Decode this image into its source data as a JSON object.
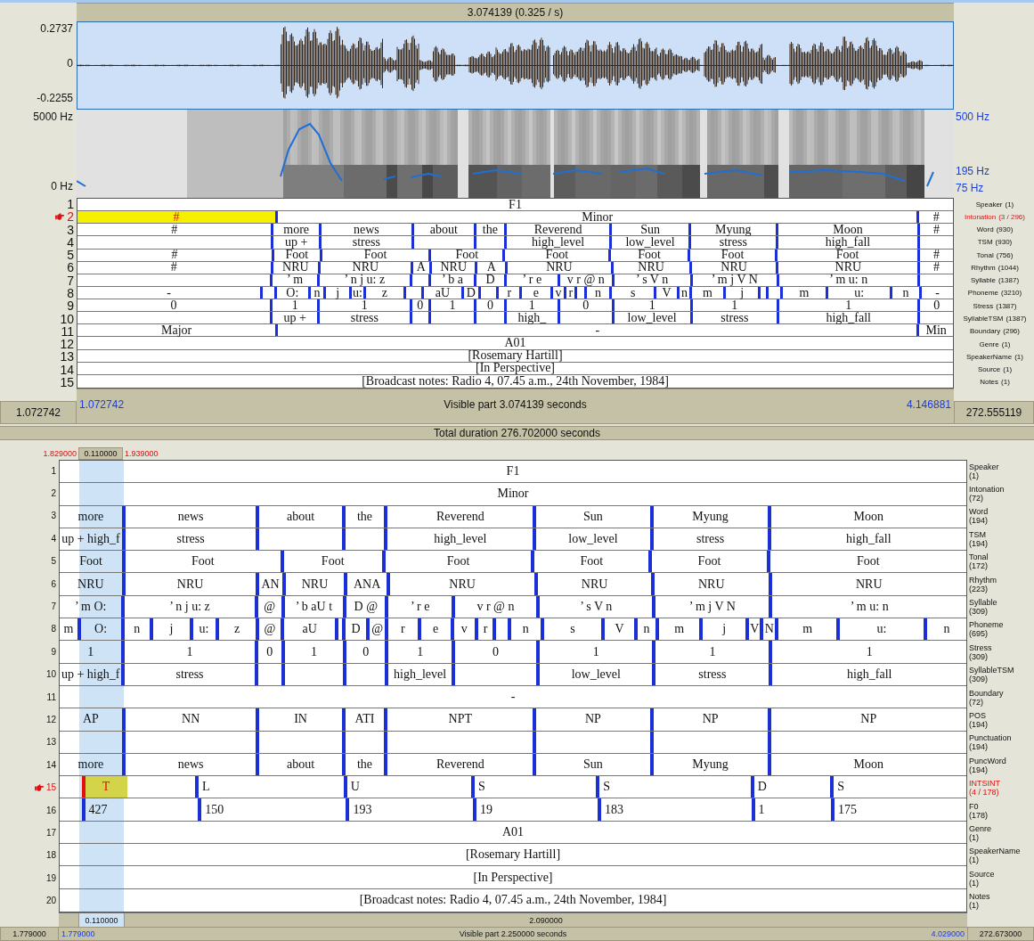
{
  "top_panel": {
    "title": "3.074139 (0.325 / s)",
    "waveform": {
      "y_max": "0.2737",
      "y_zero": "0",
      "y_min": "-0.2255"
    },
    "spectrogram": {
      "freq_max": "5000 Hz",
      "freq_min": "0 Hz",
      "pitch_max": "500 Hz",
      "pitch_mid": "195 Hz",
      "pitch_min": "75 Hz"
    },
    "tiers": [
      {
        "number": "1",
        "selected": false,
        "name": "Speaker",
        "count": "(1)",
        "intervals": [
          {
            "text": "F1",
            "selected": false
          }
        ]
      },
      {
        "number": "2",
        "selected": true,
        "name": "Intonation",
        "count": "(3 / 296)",
        "intervals": [
          {
            "text": "#",
            "selected": true
          },
          {
            "text": "Minor",
            "selected": false
          },
          {
            "text": "#",
            "selected": false
          }
        ]
      },
      {
        "number": "3",
        "selected": false,
        "name": "Word",
        "count": "(930)",
        "intervals": [
          {
            "text": "#",
            "selected": false
          },
          {
            "text": "more",
            "selected": false
          },
          {
            "text": "news",
            "selected": false
          },
          {
            "text": "about",
            "selected": false
          },
          {
            "text": "the",
            "selected": false
          },
          {
            "text": "Reverend",
            "selected": false
          },
          {
            "text": "Sun",
            "selected": false
          },
          {
            "text": "Myung",
            "selected": false
          },
          {
            "text": "Moon",
            "selected": false
          },
          {
            "text": "#",
            "selected": false
          }
        ]
      },
      {
        "number": "4",
        "selected": false,
        "name": "TSM",
        "count": "(930)",
        "intervals": [
          {
            "selected": false
          },
          {
            "text": "up +",
            "selected": false
          },
          {
            "text": "stress",
            "selected": false
          },
          {
            "selected": false
          },
          {
            "selected": false
          },
          {
            "text": "high_level",
            "selected": false
          },
          {
            "text": "low_level",
            "selected": false
          },
          {
            "text": "stress",
            "selected": false
          },
          {
            "text": "high_fall",
            "selected": false
          },
          {
            "selected": false
          }
        ]
      },
      {
        "number": "5",
        "selected": false,
        "name": "Tonal",
        "count": "(756)",
        "intervals": [
          {
            "text": "#",
            "selected": false
          },
          {
            "text": "Foot",
            "selected": false
          },
          {
            "text": "Foot",
            "selected": false
          },
          {
            "text": "Foot",
            "selected": false
          },
          {
            "text": "Foot",
            "selected": false
          },
          {
            "text": "Foot",
            "selected": false
          },
          {
            "text": "Foot",
            "selected": false
          },
          {
            "text": "Foot",
            "selected": false
          },
          {
            "text": "#",
            "selected": false
          }
        ]
      },
      {
        "number": "6",
        "selected": false,
        "name": "Rhythm",
        "count": "(1044)",
        "intervals": [
          {
            "text": "#",
            "selected": false
          },
          {
            "text": "NRU",
            "selected": false
          },
          {
            "text": "NRU",
            "selected": false
          },
          {
            "text": "A",
            "selected": false
          },
          {
            "text": "NRU",
            "selected": false
          },
          {
            "text": "A",
            "selected": false
          },
          {
            "text": "NRU",
            "selected": false
          },
          {
            "text": "NRU",
            "selected": false
          },
          {
            "text": "NRU",
            "selected": false
          },
          {
            "text": "NRU",
            "selected": false
          },
          {
            "text": "#",
            "selected": false
          }
        ]
      },
      {
        "number": "7",
        "selected": false,
        "name": "Syllable",
        "count": "(1387)",
        "intervals": [
          {
            "selected": false
          },
          {
            "text": "’ m",
            "selected": false
          },
          {
            "text": "’ n j u: z",
            "selected": false
          },
          {
            "selected": false
          },
          {
            "text": "’ b a",
            "selected": false
          },
          {
            "text": "D",
            "selected": false
          },
          {
            "text": "’ r e",
            "selected": false
          },
          {
            "text": "v r @ n",
            "selected": false
          },
          {
            "text": "’ s V n",
            "selected": false
          },
          {
            "text": "’ m j V N",
            "selected": false
          },
          {
            "text": "’ m u: n",
            "selected": false
          },
          {
            "selected": false
          }
        ]
      },
      {
        "number": "8",
        "selected": false,
        "name": "Phoneme",
        "count": "(3210)",
        "intervals": [
          {
            "text": "-",
            "selected": false
          },
          {
            "selected": false
          },
          {
            "text": "O:",
            "selected": false
          },
          {
            "text": "n",
            "selected": false
          },
          {
            "text": "j",
            "selected": false
          },
          {
            "text": "u:",
            "selected": false
          },
          {
            "text": "z",
            "selected": false
          },
          {
            "selected": false
          },
          {
            "text": "aU",
            "selected": false
          },
          {
            "text": "D",
            "selected": false
          },
          {
            "selected": false
          },
          {
            "text": "r",
            "selected": false
          },
          {
            "text": "e",
            "selected": false
          },
          {
            "text": "v",
            "selected": false
          },
          {
            "text": "r",
            "selected": false
          },
          {
            "selected": false
          },
          {
            "text": "n",
            "selected": false
          },
          {
            "text": "s",
            "selected": false
          },
          {
            "text": "V",
            "selected": false
          },
          {
            "text": "n",
            "selected": false
          },
          {
            "text": "m",
            "selected": false
          },
          {
            "text": "j",
            "selected": false
          },
          {
            "selected": false
          },
          {
            "selected": false
          },
          {
            "text": "m",
            "selected": false
          },
          {
            "text": "u:",
            "selected": false
          },
          {
            "text": "n",
            "selected": false
          },
          {
            "text": "-",
            "selected": false
          }
        ]
      },
      {
        "number": "9",
        "selected": false,
        "name": "Stress",
        "count": "(1387)",
        "intervals": [
          {
            "text": "0",
            "selected": false
          },
          {
            "text": "1",
            "selected": false
          },
          {
            "text": "1",
            "selected": false
          },
          {
            "text": "0",
            "selected": false
          },
          {
            "text": "1",
            "selected": false
          },
          {
            "text": "0",
            "selected": false
          },
          {
            "text": "1",
            "selected": false
          },
          {
            "text": "0",
            "selected": false
          },
          {
            "text": "1",
            "selected": false
          },
          {
            "text": "1",
            "selected": false
          },
          {
            "text": "1",
            "selected": false
          },
          {
            "text": "0",
            "selected": false
          }
        ]
      },
      {
        "number": "10",
        "selected": false,
        "name": "SyllableTSM",
        "count": "(1387)",
        "intervals": [
          {
            "selected": false
          },
          {
            "text": "up +",
            "selected": false
          },
          {
            "text": "stress",
            "selected": false
          },
          {
            "selected": false
          },
          {
            "selected": false
          },
          {
            "selected": false
          },
          {
            "text": "high_",
            "selected": false
          },
          {
            "selected": false
          },
          {
            "text": "low_level",
            "selected": false
          },
          {
            "text": "stress",
            "selected": false
          },
          {
            "text": "high_fall",
            "selected": false
          },
          {
            "selected": false
          }
        ]
      },
      {
        "number": "11",
        "selected": false,
        "name": "Boundary",
        "count": "(296)",
        "intervals": [
          {
            "text": "Major",
            "selected": false
          },
          {
            "text": "-",
            "selected": false
          },
          {
            "text": "Min",
            "selected": false
          }
        ]
      },
      {
        "number": "12",
        "selected": false,
        "name": "Genre",
        "count": "(1)",
        "intervals": [
          {
            "text": "A01",
            "selected": false
          }
        ]
      },
      {
        "number": "13",
        "selected": false,
        "name": "SpeakerName",
        "count": "(1)",
        "intervals": [
          {
            "text": "[Rosemary Hartill]",
            "selected": false
          }
        ]
      },
      {
        "number": "14",
        "selected": false,
        "name": "Source",
        "count": "(1)",
        "intervals": [
          {
            "text": "[In Perspective]",
            "selected": false
          }
        ]
      },
      {
        "number": "15",
        "selected": false,
        "name": "Notes",
        "count": "(1)",
        "intervals": [
          {
            "text": "[Broadcast notes: Radio 4, 07.45 a.m., 24th November, 1984]",
            "selected": false
          }
        ]
      }
    ],
    "footer": {
      "left_box": "1.072742",
      "window_start": "1.072742",
      "visible": "Visible part 3.074139 seconds",
      "window_end": "4.146881",
      "right_box": "272.555119"
    }
  },
  "total_duration": "Total duration 276.702000 seconds",
  "bottom_panel": {
    "selection": {
      "start": "1.829000",
      "duration": "0.110000",
      "end": "1.939000"
    },
    "tiers": [
      {
        "number": "1",
        "selected": false,
        "kind": "interval",
        "name": "Speaker",
        "count": "(1)",
        "intervals": [
          {
            "text": "F1",
            "selected": false
          }
        ]
      },
      {
        "number": "2",
        "selected": false,
        "kind": "interval",
        "name": "Intonation",
        "count": "(72)",
        "intervals": [
          {
            "text": "Minor",
            "selected": false
          }
        ]
      },
      {
        "number": "3",
        "selected": false,
        "kind": "interval",
        "name": "Word",
        "count": "(194)",
        "intervals": [
          {
            "text": "more",
            "selected": false
          },
          {
            "text": "news",
            "selected": false
          },
          {
            "text": "about",
            "selected": false
          },
          {
            "text": "the",
            "selected": false
          },
          {
            "text": "Reverend",
            "selected": false
          },
          {
            "text": "Sun",
            "selected": false
          },
          {
            "text": "Myung",
            "selected": false
          },
          {
            "text": "Moon",
            "selected": false
          }
        ]
      },
      {
        "number": "4",
        "selected": false,
        "kind": "interval",
        "name": "TSM",
        "count": "(194)",
        "intervals": [
          {
            "text": "up + high_f",
            "selected": false
          },
          {
            "text": "stress",
            "selected": false
          },
          {
            "selected": false
          },
          {
            "selected": false
          },
          {
            "text": "high_level",
            "selected": false
          },
          {
            "text": "low_level",
            "selected": false
          },
          {
            "text": "stress",
            "selected": false
          },
          {
            "text": "high_fall",
            "selected": false
          }
        ]
      },
      {
        "number": "5",
        "selected": false,
        "kind": "interval",
        "name": "Tonal",
        "count": "(172)",
        "intervals": [
          {
            "text": "Foot",
            "selected": false
          },
          {
            "text": "Foot",
            "selected": false
          },
          {
            "text": "Foot",
            "selected": false
          },
          {
            "text": "Foot",
            "selected": false
          },
          {
            "text": "Foot",
            "selected": false
          },
          {
            "text": "Foot",
            "selected": false
          },
          {
            "text": "Foot",
            "selected": false
          }
        ]
      },
      {
        "number": "6",
        "selected": false,
        "kind": "interval",
        "name": "Rhythm",
        "count": "(223)",
        "intervals": [
          {
            "text": "NRU",
            "selected": false
          },
          {
            "text": "NRU",
            "selected": false
          },
          {
            "text": "AN",
            "selected": false
          },
          {
            "text": "NRU",
            "selected": false
          },
          {
            "text": "ANA",
            "selected": false
          },
          {
            "text": "NRU",
            "selected": false
          },
          {
            "text": "NRU",
            "selected": false
          },
          {
            "text": "NRU",
            "selected": false
          },
          {
            "text": "NRU",
            "selected": false
          }
        ]
      },
      {
        "number": "7",
        "selected": false,
        "kind": "interval",
        "name": "Syllable",
        "count": "(309)",
        "intervals": [
          {
            "text": "’ m O:",
            "selected": false
          },
          {
            "text": "’ n j u: z",
            "selected": false
          },
          {
            "text": "@",
            "selected": false
          },
          {
            "text": "’ b aU t",
            "selected": false
          },
          {
            "text": "D @",
            "selected": false
          },
          {
            "text": "’ r e",
            "selected": false
          },
          {
            "text": "v r @ n",
            "selected": false
          },
          {
            "text": "’ s V n",
            "selected": false
          },
          {
            "text": "’ m j V N",
            "selected": false
          },
          {
            "text": "’ m u: n",
            "selected": false
          }
        ]
      },
      {
        "number": "8",
        "selected": false,
        "kind": "interval",
        "name": "Phoneme",
        "count": "(695)",
        "intervals": [
          {
            "text": "m",
            "selected": false
          },
          {
            "text": "O:",
            "selected": false
          },
          {
            "text": "n",
            "selected": false
          },
          {
            "text": "j",
            "selected": false
          },
          {
            "text": "u:",
            "selected": false
          },
          {
            "text": "z",
            "selected": false
          },
          {
            "text": "@",
            "selected": false
          },
          {
            "text": "aU",
            "selected": false
          },
          {
            "selected": false
          },
          {
            "text": "D",
            "selected": false
          },
          {
            "text": "@",
            "selected": false
          },
          {
            "text": "r",
            "selected": false
          },
          {
            "text": "e",
            "selected": false
          },
          {
            "text": "v",
            "selected": false
          },
          {
            "text": "r",
            "selected": false
          },
          {
            "selected": false
          },
          {
            "text": "n",
            "selected": false
          },
          {
            "text": "s",
            "selected": false
          },
          {
            "text": "V",
            "selected": false
          },
          {
            "text": "n",
            "selected": false
          },
          {
            "text": "m",
            "selected": false
          },
          {
            "text": "j",
            "selected": false
          },
          {
            "text": "V",
            "selected": false
          },
          {
            "text": "N",
            "selected": false
          },
          {
            "text": "m",
            "selected": false
          },
          {
            "text": "u:",
            "selected": false
          },
          {
            "text": "n",
            "selected": false
          }
        ]
      },
      {
        "number": "9",
        "selected": false,
        "kind": "interval",
        "name": "Stress",
        "count": "(309)",
        "intervals": [
          {
            "text": "1",
            "selected": false
          },
          {
            "text": "1",
            "selected": false
          },
          {
            "text": "0",
            "selected": false
          },
          {
            "text": "1",
            "selected": false
          },
          {
            "text": "0",
            "selected": false
          },
          {
            "text": "1",
            "selected": false
          },
          {
            "text": "0",
            "selected": false
          },
          {
            "text": "1",
            "selected": false
          },
          {
            "text": "1",
            "selected": false
          },
          {
            "text": "1",
            "selected": false
          }
        ]
      },
      {
        "number": "10",
        "selected": false,
        "kind": "interval",
        "name": "SyllableTSM",
        "count": "(309)",
        "intervals": [
          {
            "text": "up + high_f",
            "selected": false
          },
          {
            "text": "stress",
            "selected": false
          },
          {
            "selected": false
          },
          {
            "selected": false
          },
          {
            "selected": false
          },
          {
            "text": "high_level",
            "selected": false
          },
          {
            "selected": false
          },
          {
            "text": "low_level",
            "selected": false
          },
          {
            "text": "stress",
            "selected": false
          },
          {
            "text": "high_fall",
            "selected": false
          }
        ]
      },
      {
        "number": "11",
        "selected": false,
        "kind": "interval",
        "name": "Boundary",
        "count": "(72)",
        "intervals": [
          {
            "text": "-",
            "selected": false
          }
        ]
      },
      {
        "number": "12",
        "selected": false,
        "kind": "interval",
        "name": "POS",
        "count": "(194)",
        "intervals": [
          {
            "text": "AP",
            "selected": false
          },
          {
            "text": "NN",
            "selected": false
          },
          {
            "text": "IN",
            "selected": false
          },
          {
            "text": "ATI",
            "selected": false
          },
          {
            "text": "NPT",
            "selected": false
          },
          {
            "text": "NP",
            "selected": false
          },
          {
            "text": "NP",
            "selected": false
          },
          {
            "text": "NP",
            "selected": false
          }
        ]
      },
      {
        "number": "13",
        "selected": false,
        "kind": "interval",
        "name": "Punctuation",
        "count": "(194)",
        "intervals": [
          {
            "selected": false
          },
          {
            "selected": false
          },
          {
            "selected": false
          },
          {
            "selected": false
          },
          {
            "selected": false
          },
          {
            "selected": false
          },
          {
            "selected": false
          },
          {
            "selected": false
          }
        ]
      },
      {
        "number": "14",
        "selected": false,
        "kind": "interval",
        "name": "PuncWord",
        "count": "(194)",
        "intervals": [
          {
            "text": "more",
            "selected": false
          },
          {
            "text": "news",
            "selected": false
          },
          {
            "text": "about",
            "selected": false
          },
          {
            "text": "the",
            "selected": false
          },
          {
            "text": "Reverend",
            "selected": false
          },
          {
            "text": "Sun",
            "selected": false
          },
          {
            "text": "Myung",
            "selected": false
          },
          {
            "text": "Moon",
            "selected": false
          }
        ]
      },
      {
        "number": "15",
        "selected": true,
        "kind": "point",
        "name": "INTSINT",
        "count": "(4 / 178)",
        "intervals": [
          {
            "selected": false
          },
          {
            "text": "T",
            "selected": true
          },
          {
            "selected": false
          },
          {
            "text": "L",
            "selected": false
          },
          {
            "text": "U",
            "selected": false
          },
          {
            "text": "S",
            "selected": false
          },
          {
            "text": "S",
            "selected": false
          },
          {
            "text": "D",
            "selected": false
          },
          {
            "text": "S",
            "selected": false
          }
        ]
      },
      {
        "number": "16",
        "selected": false,
        "kind": "point",
        "name": "F0",
        "count": "(178)",
        "intervals": [
          {
            "selected": false
          },
          {
            "text": "427",
            "selected": false
          },
          {
            "selected": false
          },
          {
            "text": "150",
            "selected": false
          },
          {
            "text": "193",
            "selected": false
          },
          {
            "text": "19",
            "selected": false
          },
          {
            "text": "183",
            "selected": false
          },
          {
            "text": "1",
            "selected": false
          },
          {
            "text": "175",
            "selected": false
          }
        ]
      },
      {
        "number": "17",
        "selected": false,
        "kind": "interval",
        "name": "Genre",
        "count": "(1)",
        "intervals": [
          {
            "text": "A01",
            "selected": false
          }
        ]
      },
      {
        "number": "18",
        "selected": false,
        "kind": "interval",
        "name": "SpeakerName",
        "count": "(1)",
        "intervals": [
          {
            "text": "[Rosemary Hartill]",
            "selected": false
          }
        ]
      },
      {
        "number": "19",
        "selected": false,
        "kind": "interval",
        "name": "Source",
        "count": "(1)",
        "intervals": [
          {
            "text": "[In Perspective]",
            "selected": false
          }
        ]
      },
      {
        "number": "20",
        "selected": false,
        "kind": "interval",
        "name": "Notes",
        "count": "(1)",
        "intervals": [
          {
            "text": "[Broadcast notes: Radio 4, 07.45 a.m., 24th November, 1984]",
            "selected": false
          }
        ]
      }
    ],
    "scale": {
      "selection_duration": "0.110000",
      "after_selection": "2.090000"
    },
    "footer": {
      "left_box": "1.779000",
      "window_start": "1.779000",
      "visible": "Visible part 2.250000 seconds",
      "window_end": "4.029000",
      "right_box": "272.673000"
    }
  }
}
